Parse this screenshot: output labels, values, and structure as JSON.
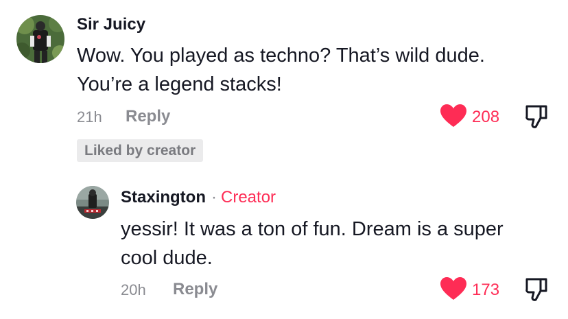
{
  "comment": {
    "username": "Sir Juicy",
    "text_line1": "Wow. You played as techno? That’s wild dude.",
    "text_line2": "You’re a legend stacks!",
    "timestamp": "21h",
    "reply_label": "Reply",
    "like_count": "208",
    "liked_badge": "Liked by creator"
  },
  "reply": {
    "username": "Staxington",
    "separator": "·",
    "creator_tag": "Creator",
    "text_line1": "yessir! It was a ton of fun. Dream is a super",
    "text_line2": "cool dude.",
    "timestamp": "20h",
    "reply_label": "Reply",
    "like_count": "173"
  },
  "colors": {
    "like_red": "#fe2c55",
    "muted_gray": "#8a8b91",
    "text_dark": "#161823",
    "badge_bg": "#ebebec"
  },
  "icons": {
    "like": "heart-filled-icon",
    "dislike": "thumbs-down-icon",
    "avatar_comment": "user-avatar",
    "avatar_reply": "creator-avatar"
  }
}
